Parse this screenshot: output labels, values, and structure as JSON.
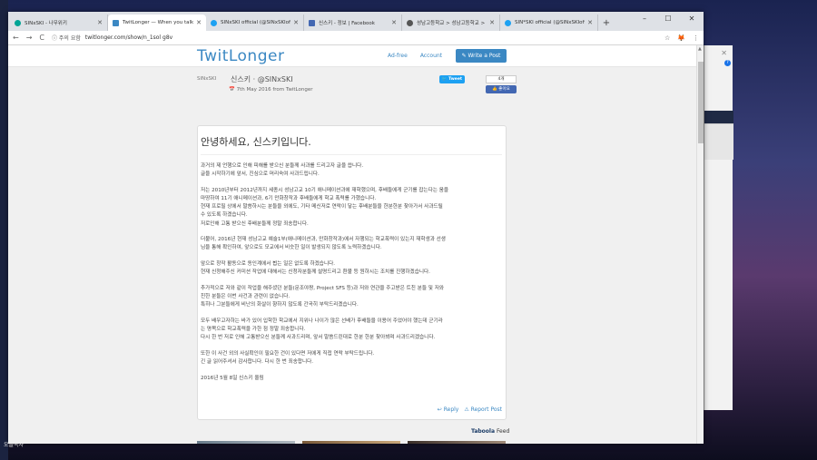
{
  "desktop": {
    "label": "오늘목차"
  },
  "window_controls": {
    "minimize": "–",
    "maximize": "☐",
    "close": "✕"
  },
  "tabs": [
    {
      "label": "SINxSKI - 나무위키",
      "fav_color": "#00a495",
      "active": false
    },
    {
      "label": "TwitLonger — When you talk t",
      "fav_color": "#3b88c3",
      "active": true
    },
    {
      "label": "SINxSKI official (@SINxSKIoffic",
      "fav_color": "#1da1f2",
      "active": false
    },
    {
      "label": "신스키 - 정보 | Facebook",
      "fav_color": "#4267b2",
      "active": false
    },
    {
      "label": "성남고등학교 > 성남고등학교 >",
      "fav_color": "#555555",
      "active": false
    },
    {
      "label": "SIN*SKI official (@SINxSKIoffic",
      "fav_color": "#1da1f2",
      "active": false
    }
  ],
  "new_tab": "+",
  "toolbar": {
    "back": "←",
    "forward": "→",
    "reload": "C",
    "security_label": "ⓘ 주의 요함",
    "url": "twitlonger.com/show/n_1sol g8v",
    "star": "☆",
    "ext": "🦊",
    "menu": "⋮"
  },
  "site": {
    "logo": "TwitLonger",
    "nav": [
      "Ad-free",
      "Account"
    ],
    "write_button": "✎ Write a Post"
  },
  "author": {
    "avatar_alt": "SINxSKI",
    "name": "신스키 · @SINxSKI",
    "date": "📅 7th May 2016 from TwitLonger",
    "tweet_button": "🐦 Tweet",
    "fb_count": "4개",
    "fb_button": "👍 좋아요"
  },
  "post": {
    "title": "안녕하세요, 신스키입니다.",
    "paragraphs": [
      "과거의 제 언행으로 인해 피해를 받으신 분들께 사과를 드리고자 글을 씁니다.\n글을 시작하기에 앞서, 진심으로 머리숙여 사과드립니다.",
      "저는 2010년부터 2012년까지 세종시 성남고교 10기 애니메이션과에 재학했으며, 후배들에게 군기를 잡는다는 움을\n마땅하여 11기 애니메이션과, 6기 만화창작과 후배들에게 학교 폭력를 가했습니다.\n현재 프로필 상에서 말씀하시는 분들을 외에도, 기타 메신저로 연락이 닿는 후배분들을 한분한분 찾아가서 사과드릴\n수 있도록 하겠습니다.\n저로인해 고통 받으신 후배분들께 정말 죄송합니다.",
      "더불어, 2016년 현재 성남고교 예술1부(애니메이션과, 만화창작과)에서 자행되는 학교폭력이 있는지 재학생과 선생\n님을 통해 확인하여, 앞으로도 모교에서 비슷한 일이 발생되지 않도록 노력하겠습니다.",
      "앞으로 창작 활동으로 동인계에서 뵙는 일은 없도록 하겠습니다.\n현재 신청해주신 커미션 작업에 대해서는 신청자분들께 설명드리고 환불 등 원하시는 조치를 진행하겠습니다.",
      "추가적으로 저와 같이 작업을 해주셨던 분들(문조야짱, Project SFS 등)과 저와 연관을 주고받은 트친 분들 및 저와\n친한 분들은 이번 사건과 관련이 없습니다.\n특히나 그분들에게 비난의 화살이 향하지 않도록 간곡히 부탁드리겠습니다.",
      "모두 배우고자하는 바가 있어 입학한 학교에서 지위나 나이가 많은 선배가 후배들을 이용어 주었어야 했는데 군기라\n는 명목으로 학교폭력을 가한 점 정말 죄송합니다.\n다시 한 번 저로 인해 고통받으신 분들께 사과드리며, 앞서 말씀드린대로 한분 한분 찾아뵈며 사과드리겠습니다.",
      "또한 이 사건 외의 사실확인이 필요한 건이 있다면 저에게 직접 연락 부탁드립니다.\n긴 글 읽어주셔서 감사합니다. 다시 한 번 죄송합니다.",
      "2016년 5월 8일 신스키 올림"
    ],
    "reply": "↩ Reply",
    "report": "⚠ Report Post"
  },
  "taboola": {
    "brand": "Taboola",
    "feed": "Feed"
  },
  "colors": {
    "accent": "#3b88c3",
    "twitter": "#1da1f2",
    "facebook": "#4267b2"
  }
}
